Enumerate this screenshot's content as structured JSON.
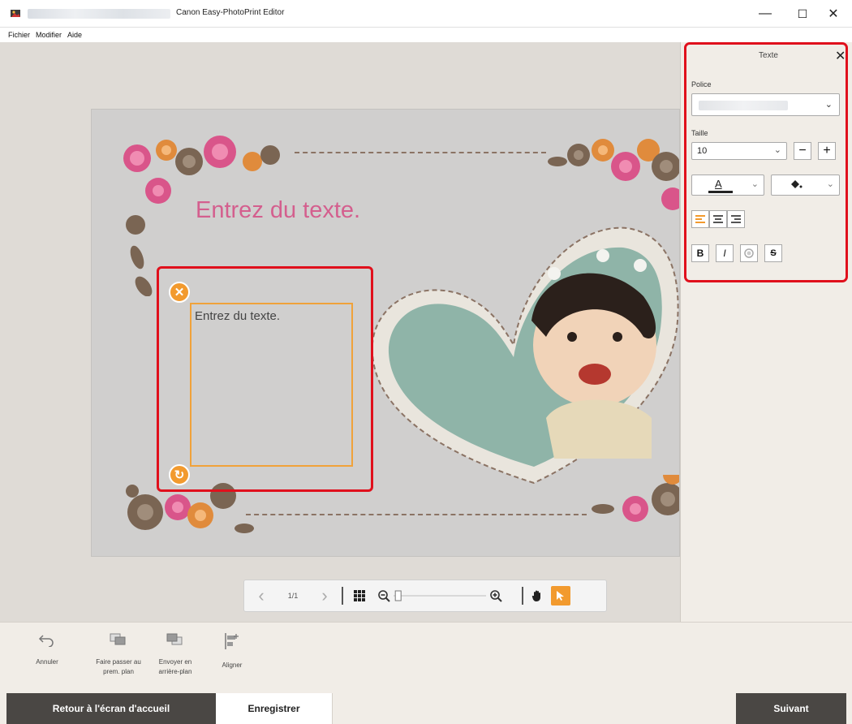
{
  "window": {
    "title": "Canon Easy-PhotoPrint Editor",
    "minimize": "—",
    "maximize": "☐",
    "close": "✕"
  },
  "menu": [
    "Fichier",
    "Modifier",
    "Aide"
  ],
  "canvas": {
    "headline": "Entrez du texte.",
    "selected_text": "Entrez du texte."
  },
  "zoombar": {
    "page_indicator": "1/1",
    "zoom_level": 0.02
  },
  "panel": {
    "title": "Texte",
    "font_label": "Police",
    "size_label": "Taille",
    "size_value": "10",
    "color_letter": "A",
    "bold": "B",
    "italic": "I",
    "strike": "S"
  },
  "tools": [
    {
      "label": "Annuler"
    },
    {
      "label": "Faire passer au prem. plan"
    },
    {
      "label": "Envoyer en arrière-plan"
    },
    {
      "label": "Aligner"
    }
  ],
  "footer": {
    "back": "Retour à l'écran d'accueil",
    "save": "Enregistrer",
    "next": "Suivant"
  },
  "colors": {
    "accent": "#f29a2e",
    "highlight": "#e0101c",
    "headline": "#d45f8e",
    "dark_button": "#4a4744"
  }
}
